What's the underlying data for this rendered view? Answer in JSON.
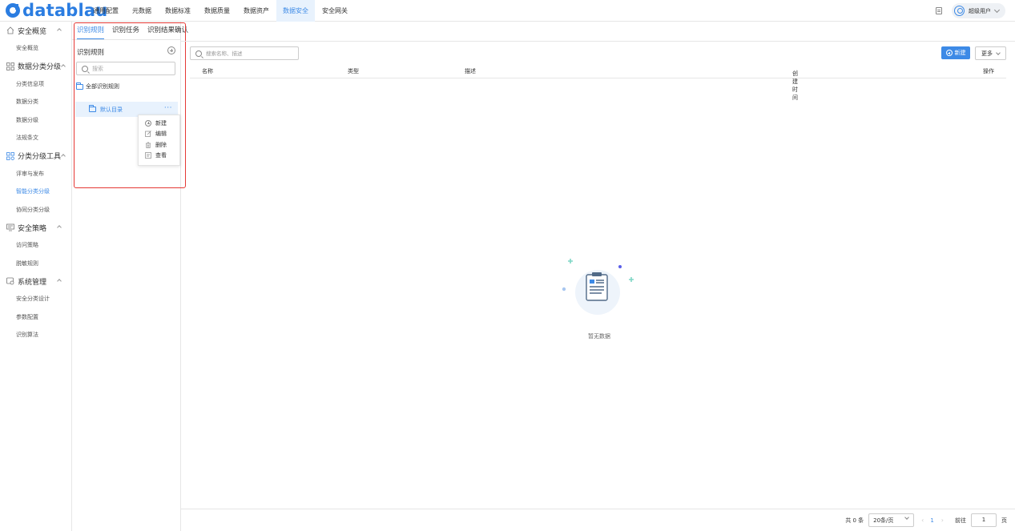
{
  "brand": {
    "name": "datablau",
    "color": "#2b7de1"
  },
  "topnav": {
    "items": [
      {
        "label": "通用配置"
      },
      {
        "label": "元数据"
      },
      {
        "label": "数据标准"
      },
      {
        "label": "数据质量"
      },
      {
        "label": "数据资产"
      },
      {
        "label": "数据安全",
        "active": true
      },
      {
        "label": "安全网关"
      }
    ],
    "user": "超级用户"
  },
  "sidebar": {
    "groups": [
      {
        "label": "安全概览",
        "icon": "home-icon",
        "items": [
          "安全概览"
        ]
      },
      {
        "label": "数据分类分级",
        "icon": "grid-icon",
        "items": [
          "分类信息项",
          "数据分类",
          "数据分级",
          "法规条文"
        ]
      },
      {
        "label": "分类分级工具",
        "icon": "apps-icon",
        "items": [
          "评审与发布",
          "智能分类分级",
          "协同分类分级"
        ],
        "active_item": "智能分类分级"
      },
      {
        "label": "安全策略",
        "icon": "monitor-icon",
        "items": [
          "访问策略",
          "脱敏规则"
        ]
      },
      {
        "label": "系统管理",
        "icon": "settings-icon",
        "items": [
          "安全分类设计",
          "参数配置",
          "识别算法"
        ]
      }
    ]
  },
  "panel": {
    "tabs": [
      "识别规则",
      "识别任务",
      "识别结果确认"
    ],
    "heading": "识别规则",
    "search_placeholder": "搜索",
    "tree_root": "全部识别规则",
    "tree_child": "默认目录",
    "tree_child_more": "···",
    "context_menu": [
      "新建",
      "编辑",
      "删除",
      "查看"
    ]
  },
  "main": {
    "search_placeholder": "搜索名称、描述",
    "new_button": "新建",
    "more_button": "更多",
    "columns": [
      "名称",
      "类型",
      "描述",
      "创建时间",
      "操作"
    ],
    "sort_glyph": "⇕",
    "empty_text": "暂无数据",
    "pager": {
      "total": "共 0 条",
      "page_size": "20条/页",
      "prev": "‹",
      "page": "1",
      "next": "›",
      "goto": "前往",
      "goto_value": "1",
      "page_unit": "页"
    }
  },
  "colors": {
    "accent": "#3d8ae6",
    "highlight_box": "#e53935",
    "active_bg": "#e8f2fd"
  }
}
